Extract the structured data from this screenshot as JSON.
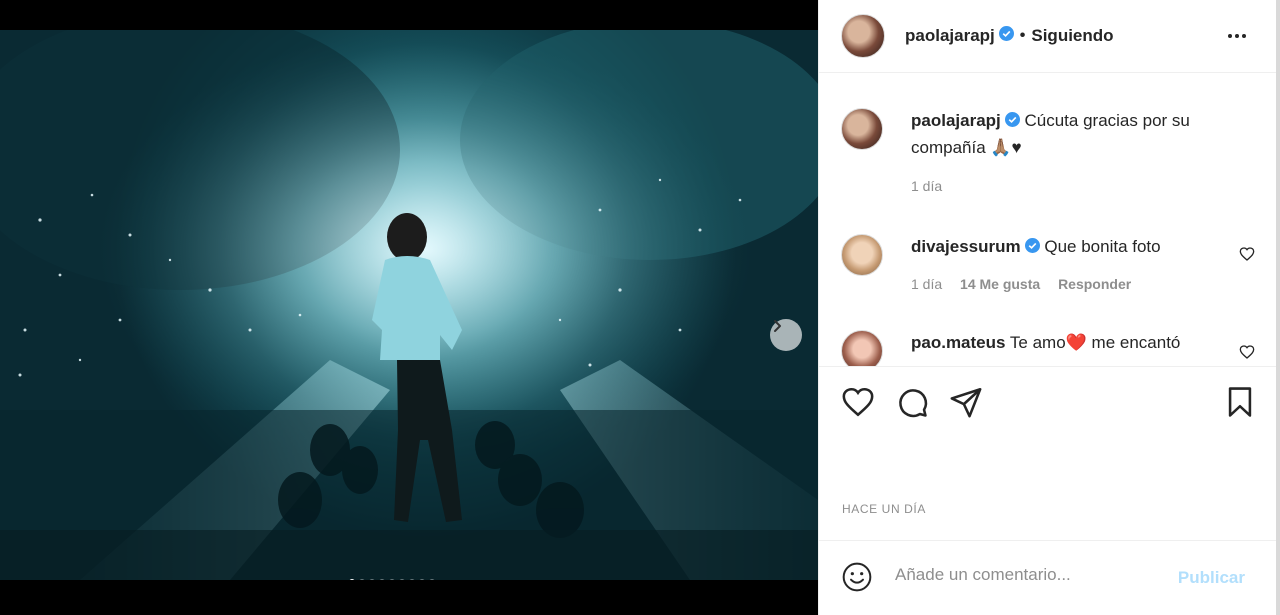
{
  "post": {
    "carousel_dot_count": 9,
    "carousel_active_index": 0
  },
  "header": {
    "username": "paolajarapj",
    "separator": "•",
    "follow_status": "Siguiendo"
  },
  "caption": {
    "username": "paolajarapj",
    "text": "Cúcuta gracias por su compañía 🙏🏽♥",
    "time": "1 día"
  },
  "comments": [
    {
      "username": "divajessurum",
      "verified": true,
      "text": "Que bonita foto",
      "time": "1 día",
      "likes": "14 Me gusta",
      "reply": "Responder"
    },
    {
      "username": "pao.mateus",
      "verified": false,
      "text": "Te amo❤️ me encantó"
    }
  ],
  "footer": {
    "timestamp": "HACE UN DÍA",
    "comment_placeholder": "Añade un comentario...",
    "publish_label": "Publicar"
  },
  "colors": {
    "verified": "#3897f0",
    "publish_disabled": "#b2dffc",
    "text": "#262626",
    "muted": "#8e8e8e"
  }
}
